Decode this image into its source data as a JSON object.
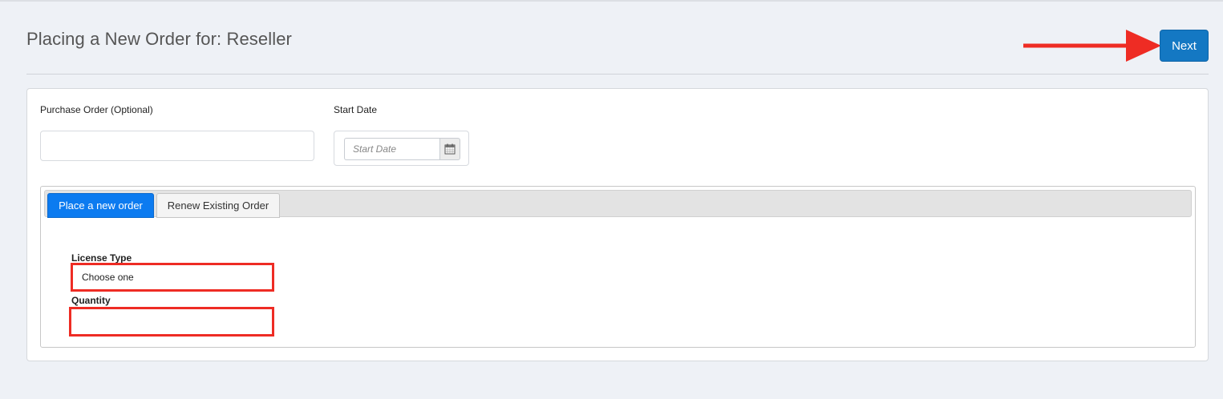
{
  "header": {
    "title": "Placing a New Order for: Reseller",
    "next_label": "Next"
  },
  "form": {
    "purchase_order": {
      "label": "Purchase Order (Optional)",
      "value": ""
    },
    "start_date": {
      "label": "Start Date",
      "placeholder": "Start Date",
      "icon": "calendar-icon"
    }
  },
  "tabs": [
    {
      "label": "Place a new order",
      "active": true
    },
    {
      "label": "Renew Existing Order",
      "active": false
    }
  ],
  "new_order": {
    "license_type": {
      "label": "License Type",
      "selected": "Choose one"
    },
    "quantity": {
      "label": "Quantity",
      "value": ""
    }
  },
  "annotations": {
    "arrow_icon": "right-arrow-icon",
    "highlight_color": "#ee2c24"
  },
  "colors": {
    "primary": "#1478c3",
    "tab_active": "#0c7bf0",
    "background": "#eef1f6"
  }
}
